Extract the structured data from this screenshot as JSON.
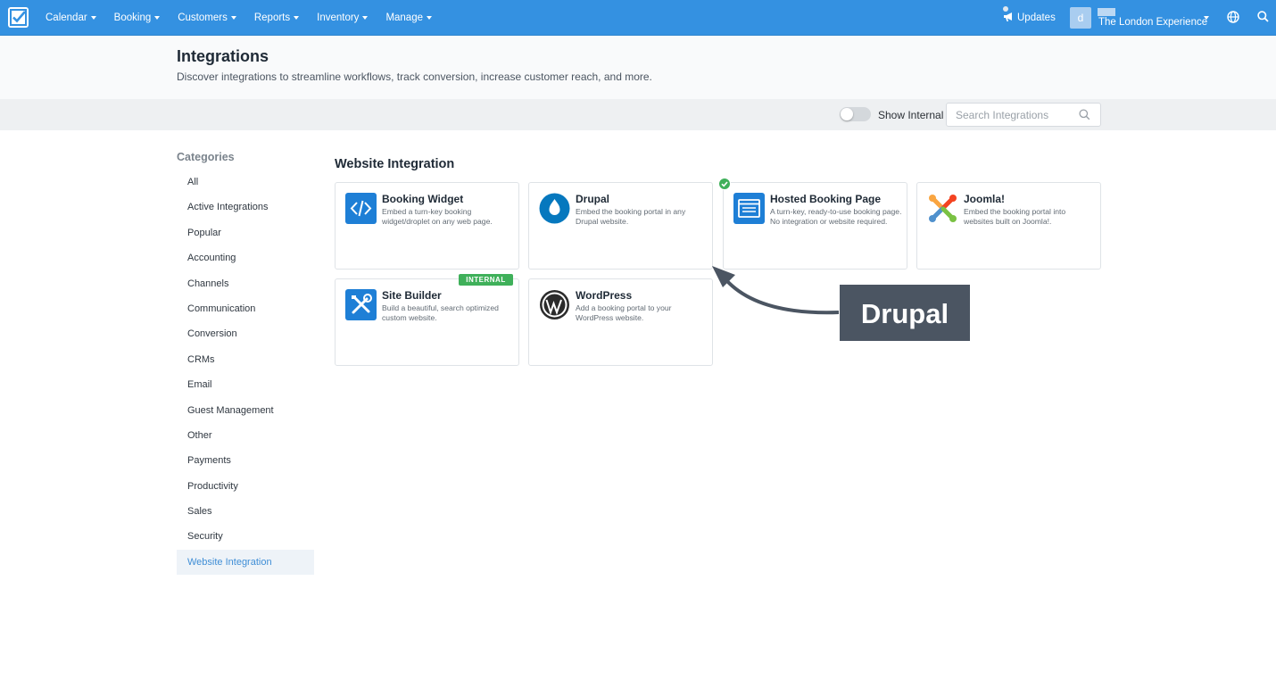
{
  "nav": {
    "menu": [
      "Calendar",
      "Booking",
      "Customers",
      "Reports",
      "Inventory",
      "Manage"
    ],
    "updates_label": "Updates",
    "avatar_letter": "d",
    "account_name": "The London Experience"
  },
  "header": {
    "title": "Integrations",
    "subtitle": "Discover integrations to streamline workflows, track conversion, increase customer reach, and more."
  },
  "filters": {
    "show_internal_label": "Show Internal",
    "show_internal_on": false,
    "search_placeholder": "Search Integrations"
  },
  "sidebar": {
    "title": "Categories",
    "items": [
      "All",
      "Active Integrations",
      "Popular",
      "Accounting",
      "Channels",
      "Communication",
      "Conversion",
      "CRMs",
      "Email",
      "Guest Management",
      "Other",
      "Payments",
      "Productivity",
      "Sales",
      "Security",
      "Website Integration"
    ],
    "active": "Website Integration"
  },
  "main": {
    "section_title": "Website Integration",
    "cards": [
      {
        "title": "Booking Widget",
        "desc": "Embed a turn-key booking widget/droplet on any web page.",
        "icon": "code-icon"
      },
      {
        "title": "Drupal",
        "desc": "Embed the booking portal in any Drupal website.",
        "icon": "drupal-icon"
      },
      {
        "title": "Hosted Booking Page",
        "desc": "A turn-key, ready-to-use booking page. No integration or website required.",
        "icon": "browser-page-icon",
        "active": true
      },
      {
        "title": "Joomla!",
        "desc": "Embed the booking portal into websites built on Joomla!.",
        "icon": "joomla-icon"
      },
      {
        "title": "Site Builder",
        "desc": "Build a beautiful, search optimized custom website.",
        "icon": "tools-icon",
        "badge": "INTERNAL"
      },
      {
        "title": "WordPress",
        "desc": "Add a booking portal to your WordPress website.",
        "icon": "wordpress-icon"
      }
    ]
  },
  "annotation": {
    "callout_text": "Drupal"
  },
  "colors": {
    "nav_blue": "#3491e1",
    "success_green": "#3fb05a",
    "callout_gray": "#4b5562"
  }
}
